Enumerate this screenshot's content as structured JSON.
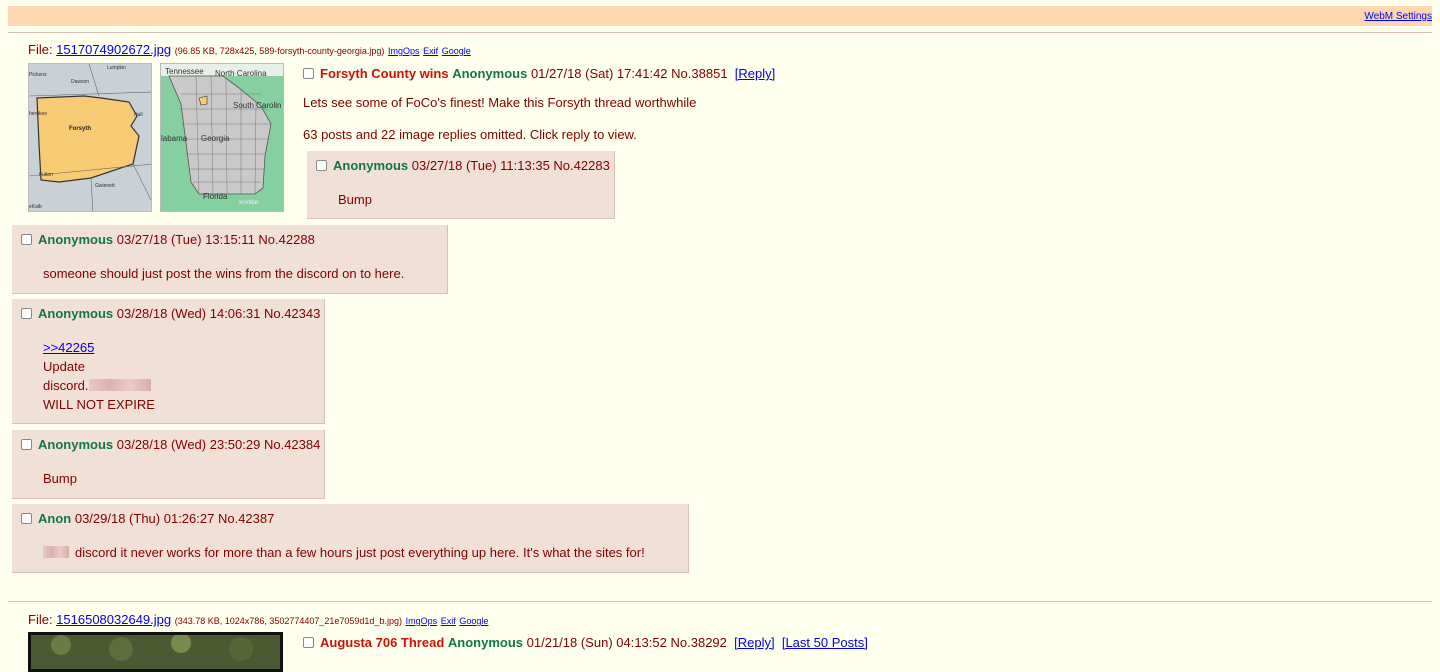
{
  "topbar": {
    "webm_settings": "WebM Settings"
  },
  "thread1": {
    "file_label": "File: ",
    "file_name": "1517074902672.jpg",
    "file_meta": "(96.85 KB, 728x425, 589-forsyth-county-georgia.jpg)",
    "links": [
      "ImgOps",
      "Exif",
      "Google"
    ],
    "thumb_labels": {
      "map1": [
        "Lumpkin",
        "Pickens",
        "Dawson",
        "Forsyth",
        "herokee",
        "Hall",
        "Fulton",
        "Gwinnett",
        "eKalb"
      ],
      "map2": [
        "Tennessee",
        "North Carolina",
        "South Carolin",
        "labama",
        "Georgia",
        "Florida",
        "worldat"
      ]
    },
    "op": {
      "subject": "Forsyth County wins",
      "name": "Anonymous",
      "datetime": "01/27/18 (Sat) 17:41:42",
      "postno": "No.38851",
      "reply_link": "[Reply]",
      "message": "Lets see some of FoCo's finest! Make this Forsyth thread worthwhile",
      "omitted": "63 posts and 22 image replies omitted. Click reply to view."
    },
    "replies": [
      {
        "name": "Anonymous",
        "datetime": "03/27/18 (Tue) 11:13:35",
        "postno": "No.42283",
        "lines": [
          "Bump"
        ]
      },
      {
        "name": "Anonymous",
        "datetime": "03/27/18 (Tue) 13:15:11",
        "postno": "No.42288",
        "lines": [
          "someone should just post the wins from the discord on to here."
        ]
      },
      {
        "name": "Anonymous",
        "datetime": "03/28/18 (Wed) 14:06:31",
        "postno": "No.42343",
        "quote": ">>42265",
        "lines": [
          "Update",
          "discord.",
          "WILL NOT EXPIRE"
        ]
      },
      {
        "name": "Anonymous",
        "datetime": "03/28/18 (Wed) 23:50:29",
        "postno": "No.42384",
        "lines": [
          "Bump"
        ]
      },
      {
        "name": "Anon",
        "datetime": "03/29/18 (Thu) 01:26:27",
        "postno": "No.42387",
        "lines": [
          "discord it never works for more than a few hours just post everything up here. It's what the sites for!"
        ]
      }
    ]
  },
  "thread2": {
    "file_label": "File: ",
    "file_name": "1516508032649.jpg",
    "file_meta": "(343.78 KB, 1024x786, 3502774407_21e7059d1d_b.jpg)",
    "links": [
      "ImgOps",
      "Exif",
      "Google"
    ],
    "op": {
      "subject": "Augusta 706 Thread",
      "name": "Anonymous",
      "datetime": "01/21/18 (Sun) 04:13:52",
      "postno": "No.38292",
      "reply_link": "[Reply]",
      "last50_link": "[Last 50 Posts]"
    }
  },
  "colors": {
    "background": "#FFFFEE",
    "text": "#800000",
    "subject": "#CC1105",
    "name": "#117743",
    "reply_bg": "#F0E0D6",
    "topbar": "#FED6AF",
    "link": "#0000EE"
  }
}
